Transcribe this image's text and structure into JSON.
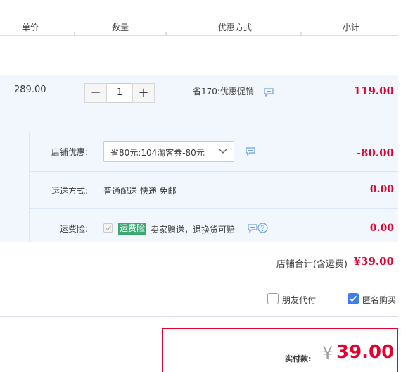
{
  "header": {
    "col_unit_price": "单价",
    "col_quantity": "数量",
    "col_discount": "优惠方式",
    "col_subtotal": "小计"
  },
  "item": {
    "unit_price": "289.00",
    "quantity": "1",
    "minus_label": "−",
    "plus_label": "+",
    "promo_text": "省170:优惠促销",
    "subtotal": "119.00"
  },
  "shop": {
    "discount_label": "店铺优惠:",
    "discount_select_value": "省80元:104淘客券-80元",
    "discount_amount": "-80.00",
    "shipping_label": "运送方式:",
    "shipping_value": "普通配送 快递 免邮",
    "shipping_amount": "0.00",
    "insurance_label": "运费险:",
    "insurance_tag": "运费险",
    "insurance_desc": "卖家赠送，退换货可赔",
    "insurance_amount": "0.00",
    "total_label": "店铺合计(含运费)",
    "total_amount": "¥39.00"
  },
  "options": {
    "friend_pay_label": "朋友代付",
    "friend_pay_checked": false,
    "anonymous_label": "匿名购买",
    "anonymous_checked": true
  },
  "payment": {
    "label": "实付款:",
    "currency": "¥",
    "amount": "39.00"
  },
  "colors": {
    "accent_red": "#e8002d",
    "checkbox_blue": "#3c7ef0",
    "tag_green": "#3aa86f",
    "row_bg": "#f2f7fd"
  },
  "icons": [
    "chat-icon",
    "help-icon",
    "chevron-down-icon",
    "check-icon"
  ]
}
